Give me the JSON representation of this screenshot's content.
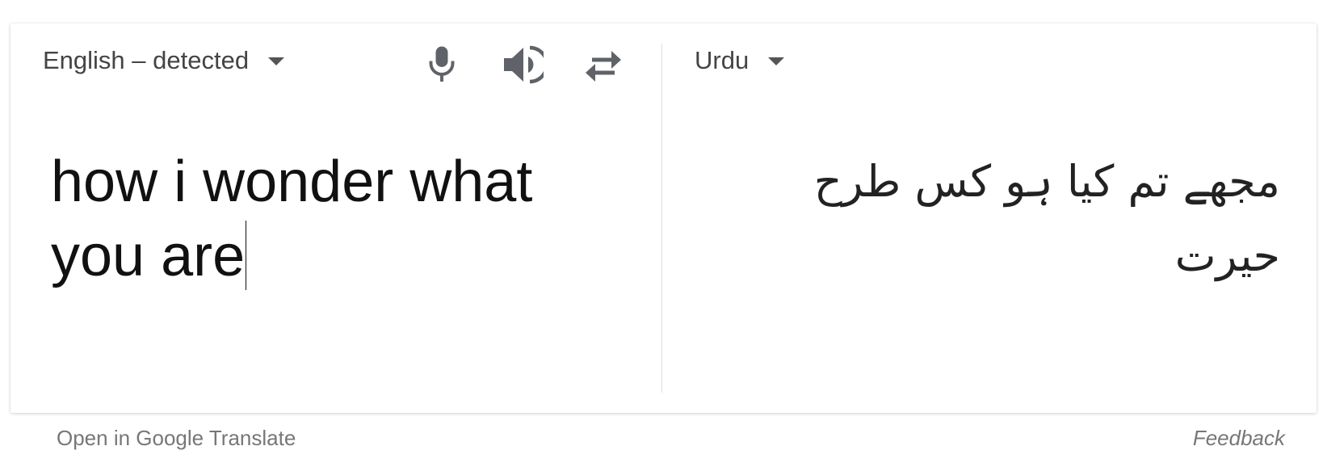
{
  "source": {
    "language_label": "English – detected",
    "text_line1": "how i wonder what",
    "text_line2": "you are"
  },
  "target": {
    "language_label": "Urdu",
    "text": "مجھے تم کیا ہو کس طرح حیرت"
  },
  "icons": {
    "mic": "microphone-icon",
    "speaker": "speaker-icon",
    "swap": "swap-languages-icon"
  },
  "footer": {
    "open_link": "Open in Google Translate",
    "feedback": "Feedback"
  },
  "colors": {
    "icon": "#5f6368",
    "text_secondary": "#777777",
    "divider": "#e0e0e0"
  }
}
